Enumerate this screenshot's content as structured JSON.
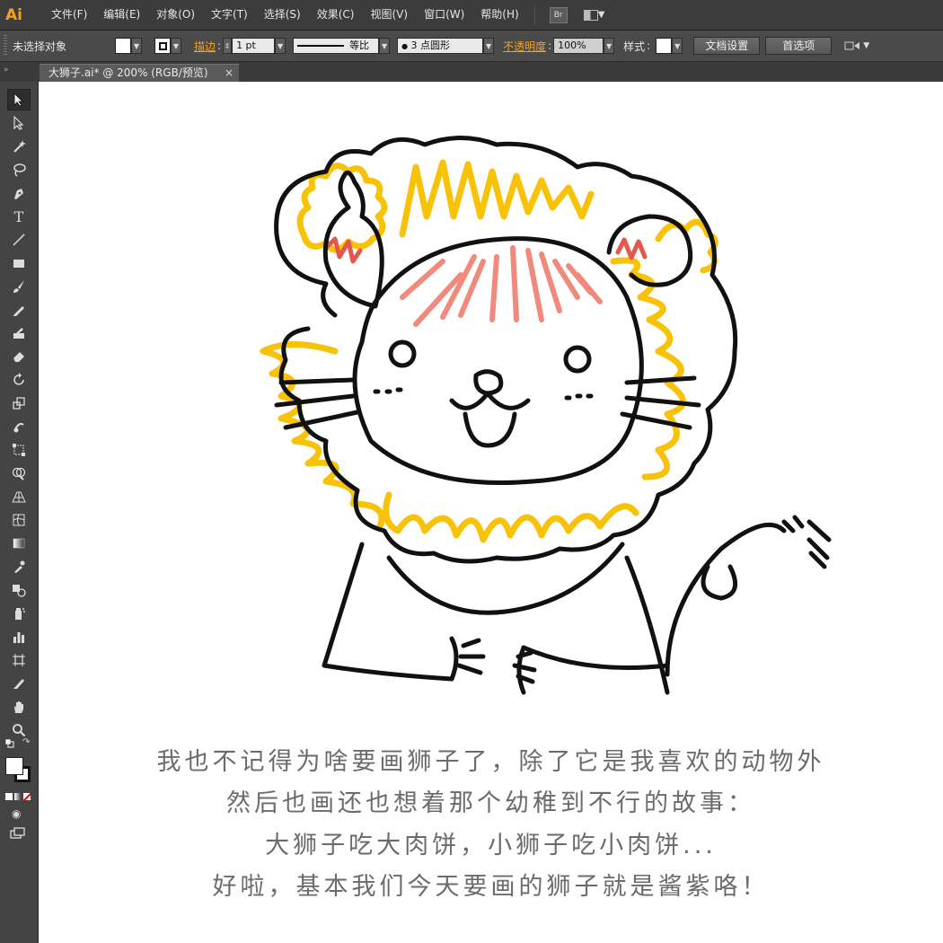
{
  "app": {
    "logo": "Ai"
  },
  "menu": {
    "items": [
      "文件(F)",
      "编辑(E)",
      "对象(O)",
      "文字(T)",
      "选择(S)",
      "效果(C)",
      "视图(V)",
      "窗口(W)",
      "帮助(H)"
    ],
    "bridge_label": "Br"
  },
  "control": {
    "selection_status": "未选择对象",
    "stroke_label": "描边",
    "stroke_weight": "1 pt",
    "profile_label": "等比",
    "brush_label": "3 点圆形",
    "opacity_label": "不透明度",
    "opacity_value": "100%",
    "style_label": "样式",
    "doc_setup": "文档设置",
    "preferences": "首选项"
  },
  "document": {
    "tab_title": "大狮子.ai* @ 200% (RGB/预览)",
    "close_glyph": "×"
  },
  "artwork": {
    "caption_lines": [
      "我也不记得为啥要画狮子了，除了它是我喜欢的动物外",
      "然后也画还也想着那个幼稚到不行的故事：",
      "大狮子吃大肉饼，小狮子吃小肉饼...",
      "好啦，基本我们今天要画的狮子就是酱紫咯！"
    ],
    "colors": {
      "outline": "#111111",
      "mane": "#f7c207",
      "hair": "#f08a7c",
      "ear": "#e2584a",
      "caption": "#6b6b6b"
    }
  },
  "tools": [
    "selection-icon",
    "direct-selection-icon",
    "magic-wand-icon",
    "lasso-icon",
    "pen-icon",
    "type-icon",
    "line-icon",
    "rectangle-icon",
    "paintbrush-icon",
    "pencil-icon",
    "blob-brush-icon",
    "eraser-icon",
    "rotate-icon",
    "scale-icon",
    "warp-icon",
    "free-transform-icon",
    "shape-builder-icon",
    "perspective-grid-icon",
    "mesh-icon",
    "gradient-icon",
    "eyedropper-icon",
    "blend-icon",
    "symbol-sprayer-icon",
    "column-graph-icon",
    "artboard-icon",
    "slice-icon",
    "hand-icon",
    "zoom-icon"
  ]
}
